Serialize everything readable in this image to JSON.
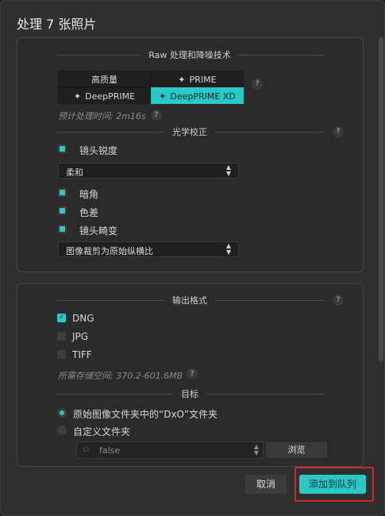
{
  "dialog": {
    "title": "处理 7 张照片"
  },
  "raw": {
    "header": "Raw 处理和降噪技术",
    "options": [
      {
        "label": "高质量",
        "sparkle": false,
        "selected": false
      },
      {
        "label": "PRIME",
        "sparkle": true,
        "selected": false
      },
      {
        "label": "DeepPRIME",
        "sparkle": true,
        "selected": false
      },
      {
        "label": "DeepPRIME XD",
        "sparkle": true,
        "selected": true
      }
    ],
    "estimate": "预计处理时间: 2m16s",
    "help": "?"
  },
  "optics": {
    "header": "光学校正",
    "lens_sharpness": "镜头锐度",
    "sharpness_select": "柔和",
    "vignetting": "暗角",
    "chromatic": "色差",
    "distortion": "镜头畸变",
    "crop_select": "图像裁剪为原始纵横比",
    "help": "?"
  },
  "output": {
    "header": "输出格式",
    "formats": [
      {
        "label": "DNG",
        "checked": true
      },
      {
        "label": "JPG",
        "checked": false
      },
      {
        "label": "TIFF",
        "checked": false
      }
    ],
    "space": "所需存储空间:  370.2-601.6MB",
    "help": "?"
  },
  "target": {
    "header": "目标",
    "original_folder": "原始图像文件夹中的“DxO”文件夹",
    "custom_folder": "自定义文件夹",
    "custom_path": "false",
    "browse": "浏览"
  },
  "footer": {
    "cancel": "取消",
    "add_to_queue": "添加到队列"
  },
  "colors": {
    "accent": "#2bc8c8",
    "highlight_frame": "#cf2a2a"
  },
  "icons": {
    "sparkle": "✦",
    "star": "☆",
    "stepper": "▲▼",
    "check": "✓"
  }
}
